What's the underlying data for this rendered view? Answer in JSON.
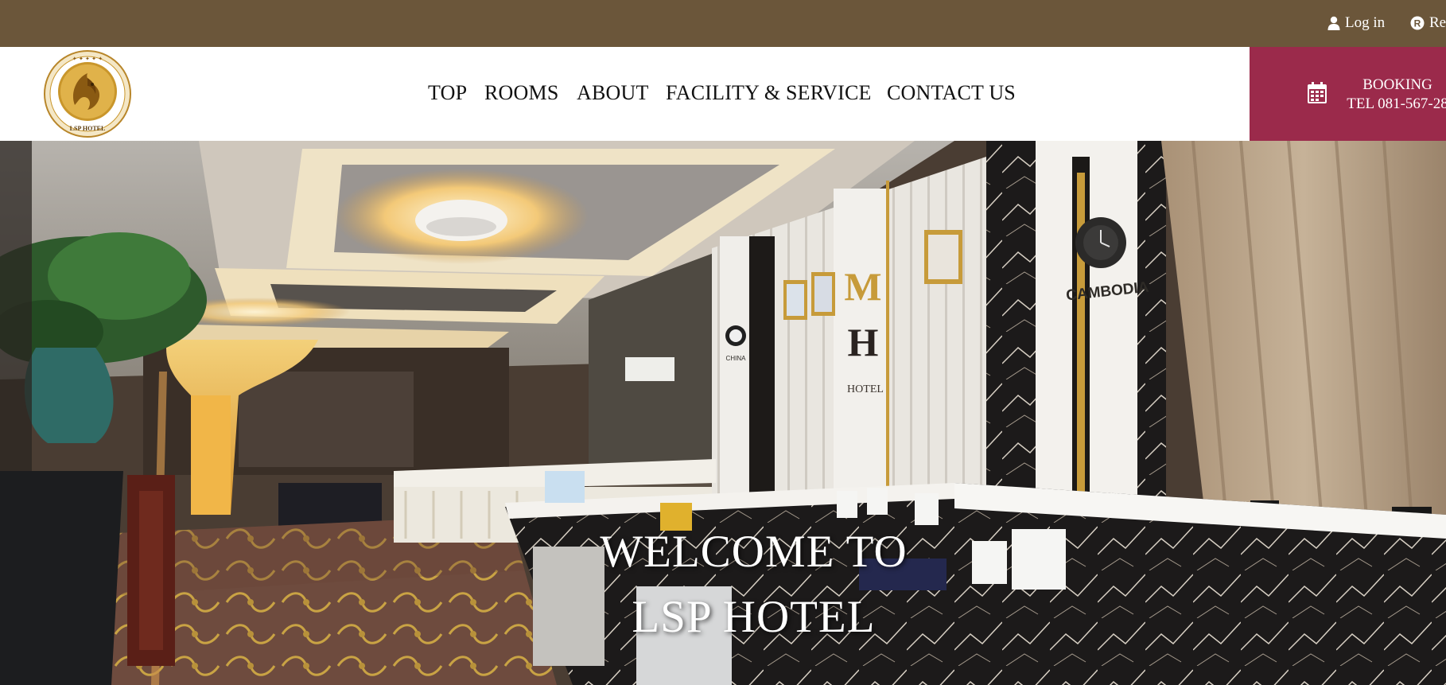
{
  "topbar": {
    "login_label": "Log in",
    "register_label": "Re",
    "login_icon": "user-icon",
    "register_icon": "registered-icon"
  },
  "header": {
    "logo_alt": "LSP HOTEL",
    "logo_text": "LSP HOTEL",
    "nav": [
      {
        "label": "TOP"
      },
      {
        "label": "ROOMS"
      },
      {
        "label": "ABOUT"
      },
      {
        "label": "FACILITY & SERVICE"
      },
      {
        "label": "CONTACT US"
      }
    ],
    "booking": {
      "icon": "calendar-icon",
      "line1": "BOOKING",
      "line2": "TEL 081-567-28"
    }
  },
  "hero": {
    "title_line1": "WELCOME TO",
    "title_line2": "LSP HOTEL",
    "photo_signs": {
      "wall_letters": [
        "M",
        "H"
      ],
      "wall_word": "HOTEL",
      "clock_label": "CAMBODIA",
      "small_clock_label": "CHINA"
    }
  },
  "colors": {
    "topbar": "#6b563a",
    "booking": "#9b2a4b",
    "header_bg": "#ffffff",
    "logo_gold": "#c9962b"
  }
}
